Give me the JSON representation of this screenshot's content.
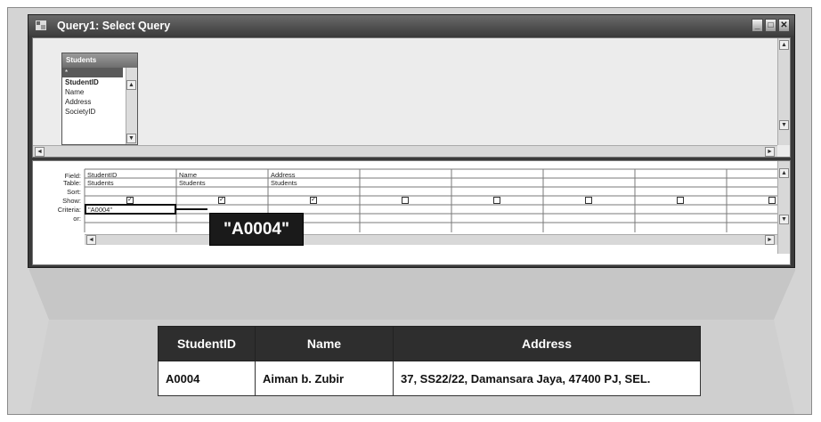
{
  "window": {
    "title": "Query1: Select Query",
    "controls": [
      "minimize",
      "maximize",
      "close"
    ]
  },
  "table_box": {
    "title": "Students",
    "fields": [
      "*",
      "StudentID",
      "Name",
      "Address",
      "SocietyID"
    ]
  },
  "design_grid": {
    "row_labels": [
      "Field:",
      "Table:",
      "Sort:",
      "Show:",
      "Criteria:",
      "or:"
    ],
    "columns": [
      {
        "field": "StudentID",
        "table": "Students",
        "sort": "",
        "show": true,
        "criteria": "\"A0004\""
      },
      {
        "field": "Name",
        "table": "Students",
        "sort": "",
        "show": true,
        "criteria": ""
      },
      {
        "field": "Address",
        "table": "Students",
        "sort": "",
        "show": true,
        "criteria": ""
      },
      {
        "field": "",
        "table": "",
        "sort": "",
        "show": false,
        "criteria": ""
      },
      {
        "field": "",
        "table": "",
        "sort": "",
        "show": false,
        "criteria": ""
      },
      {
        "field": "",
        "table": "",
        "sort": "",
        "show": false,
        "criteria": ""
      },
      {
        "field": "",
        "table": "",
        "sort": "",
        "show": false,
        "criteria": ""
      },
      {
        "field": "",
        "table": "",
        "sort": "",
        "show": false,
        "criteria": ""
      }
    ]
  },
  "callout": {
    "text": "\"A0004\""
  },
  "result_table": {
    "headers": [
      "StudentID",
      "Name",
      "Address"
    ],
    "rows": [
      [
        "A0004",
        "Aiman b. Zubir",
        "37, SS22/22, Damansara Jaya, 47400 PJ, SEL."
      ]
    ]
  },
  "colors": {
    "title_bar": "#4a4a4a",
    "background": "#d4d4d4",
    "callout": "#1a1a1a",
    "table_header": "#2e2e2e"
  }
}
